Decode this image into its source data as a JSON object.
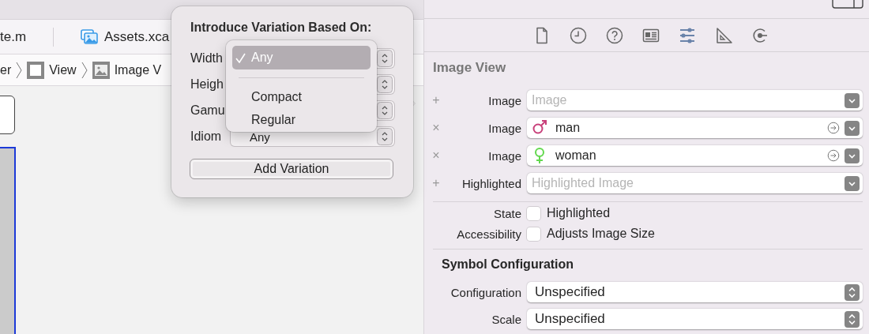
{
  "editor": {
    "tabs": [
      {
        "label": "te.m",
        "kind": "source"
      },
      {
        "label": "Assets.xca",
        "kind": "asset_catalog"
      }
    ],
    "jump_bar": [
      {
        "label": "er",
        "kind": "plain"
      },
      {
        "label": "View",
        "kind": "view"
      },
      {
        "label": "Image V",
        "kind": "image"
      }
    ]
  },
  "popover": {
    "title": "Introduce Variation Based On:",
    "rows": [
      {
        "label": "Width"
      },
      {
        "label": "Heigh"
      },
      {
        "label": "Gamu"
      },
      {
        "label": "Idiom",
        "value": "Any"
      }
    ],
    "button": "Add Variation",
    "menu": [
      {
        "label": "Any",
        "selected": true
      },
      {
        "label": "Compact",
        "selected": false
      },
      {
        "label": "Regular",
        "selected": false
      }
    ]
  },
  "inspector": {
    "tabs": [
      {
        "kind": "file",
        "selected": false
      },
      {
        "kind": "history",
        "selected": false
      },
      {
        "kind": "help",
        "selected": false
      },
      {
        "kind": "identity",
        "selected": false
      },
      {
        "kind": "attributes",
        "selected": true
      },
      {
        "kind": "size",
        "selected": false
      },
      {
        "kind": "connections",
        "selected": false
      }
    ],
    "title": "Image View",
    "image_rows": [
      {
        "action": "+",
        "label": "Image",
        "kind": "empty",
        "placeholder": "Image"
      },
      {
        "action": "×",
        "label": "Image",
        "kind": "male",
        "value": "man",
        "color": "#c8407a"
      },
      {
        "action": "×",
        "label": "Image",
        "kind": "female",
        "value": "woman",
        "color": "#62d84e"
      },
      {
        "action": "+",
        "label": "Highlighted",
        "kind": "empty",
        "placeholder": "Highlighted Image"
      }
    ],
    "checkbox_rows": [
      {
        "label": "State",
        "text": "Highlighted",
        "checked": false
      },
      {
        "label": "Accessibility",
        "text": "Adjusts Image Size",
        "checked": false
      }
    ],
    "symbol_section": {
      "title": "Symbol Configuration",
      "rows": [
        {
          "label": "Configuration",
          "value": "Unspecified"
        },
        {
          "label": "Scale",
          "value": "Unspecified"
        }
      ]
    }
  }
}
